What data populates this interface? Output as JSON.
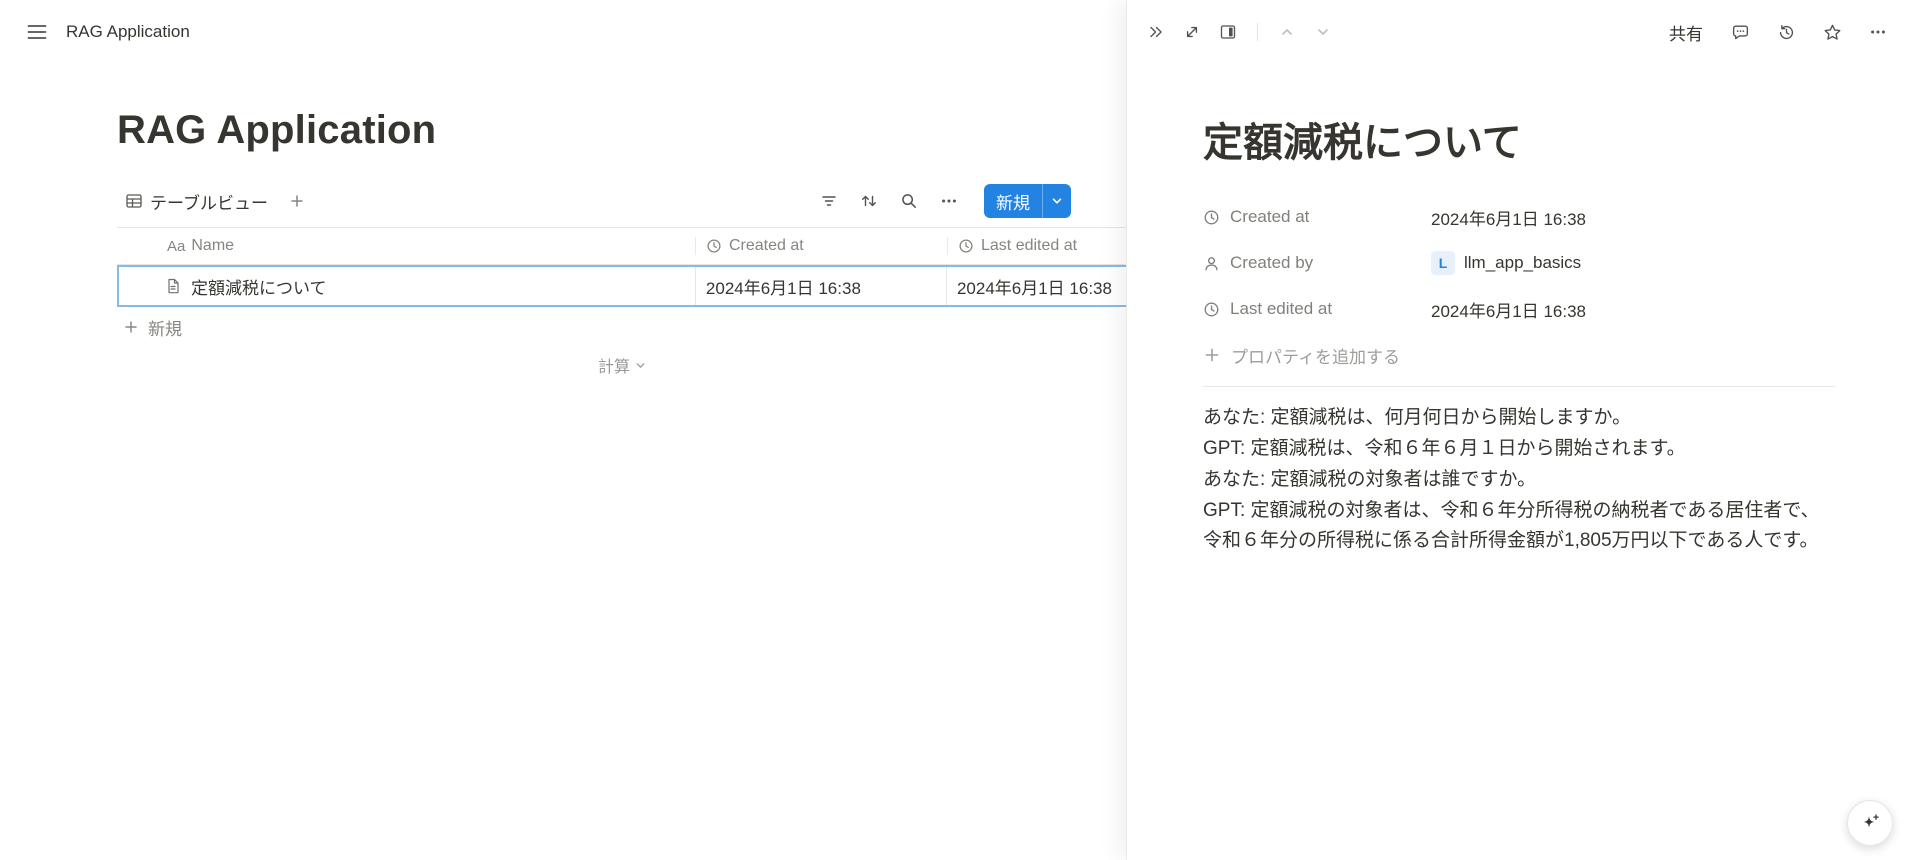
{
  "colors": {
    "accent": "#2383e2",
    "text": "#37352f",
    "muted_text": "#87857f",
    "border": "#e7e6e4",
    "row_selection_border": "#84bce9"
  },
  "topbar": {
    "title": "RAG Application"
  },
  "main": {
    "page_title": "RAG Application",
    "views": [
      {
        "label": "テーブルビュー"
      }
    ],
    "toolbar": {
      "new_label": "新規"
    },
    "table": {
      "name_type_label": "Aa",
      "columns": [
        {
          "id": "name",
          "label": "Name"
        },
        {
          "id": "created_at",
          "label": "Created at"
        },
        {
          "id": "last_edited_at",
          "label": "Last edited at"
        }
      ],
      "rows": [
        {
          "name": "定額減税について",
          "created_at": "2024年6月1日 16:38",
          "last_edited_at": "2024年6月1日 16:38"
        }
      ],
      "add_row_label": "新規",
      "footer_calc_label": "計算"
    }
  },
  "panel": {
    "topbar": {
      "share_label": "共有"
    },
    "title": "定額減税について",
    "properties": [
      {
        "icon": "clock-icon",
        "label": "Created at",
        "value": "2024年6月1日 16:38"
      },
      {
        "icon": "person-icon",
        "label": "Created by",
        "value": "llm_app_basics",
        "avatar_letter": "L"
      },
      {
        "icon": "clock-icon",
        "label": "Last edited at",
        "value": "2024年6月1日 16:38"
      }
    ],
    "add_property_label": "プロパティを追加する",
    "body": [
      "あなた: 定額減税は、何月何日から開始しますか。",
      "GPT: 定額減税は、令和６年６月１日から開始されます。",
      "あなた: 定額減税の対象者は誰ですか。",
      "GPT: 定額減税の対象者は、令和６年分所得税の納税者である居住者で、令和６年分の所得税に係る合計所得金額が1,805万円以下である人です。"
    ]
  }
}
